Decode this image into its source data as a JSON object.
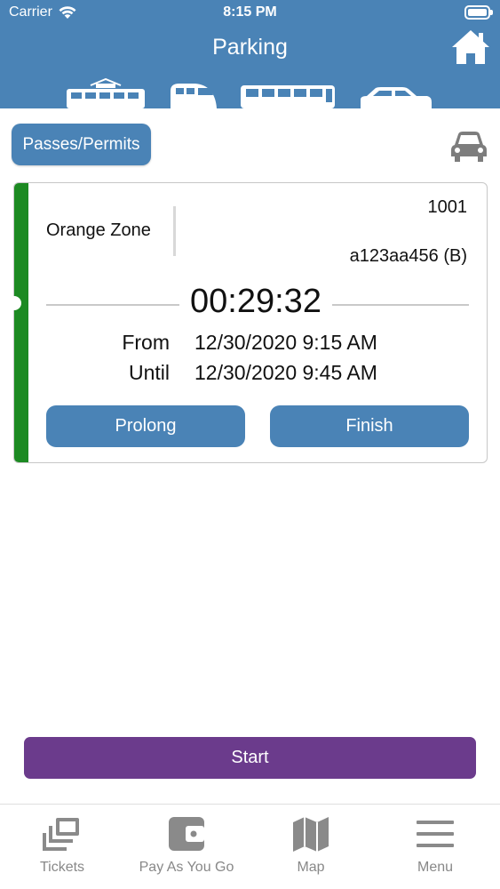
{
  "status_bar": {
    "carrier": "Carrier",
    "time": "8:15 PM"
  },
  "header": {
    "title": "Parking",
    "home_icon": "home-icon",
    "vehicle_icons": [
      "tram-icon",
      "train-icon",
      "bus-icon",
      "car-icon"
    ],
    "background_color": "#4a83b6"
  },
  "toolbar": {
    "passes_label": "Passes/Permits",
    "vehicle_icon": "car-icon"
  },
  "session": {
    "zone": "Orange Zone",
    "number": "1001",
    "plate": "a123aa456 (B)",
    "timer": "00:29:32",
    "from_label": "From",
    "from_value": "12/30/2020 9:15 AM",
    "until_label": "Until",
    "until_value": "12/30/2020 9:45 AM",
    "prolong_label": "Prolong",
    "finish_label": "Finish",
    "status_color": "#1c8a22"
  },
  "actions": {
    "start_label": "Start",
    "start_color": "#6b3b8c"
  },
  "tabbar": {
    "items": [
      {
        "label": "Tickets",
        "icon": "tickets-icon"
      },
      {
        "label": "Pay As You Go",
        "icon": "wallet-icon"
      },
      {
        "label": "Map",
        "icon": "map-icon"
      },
      {
        "label": "Menu",
        "icon": "menu-icon"
      }
    ]
  }
}
